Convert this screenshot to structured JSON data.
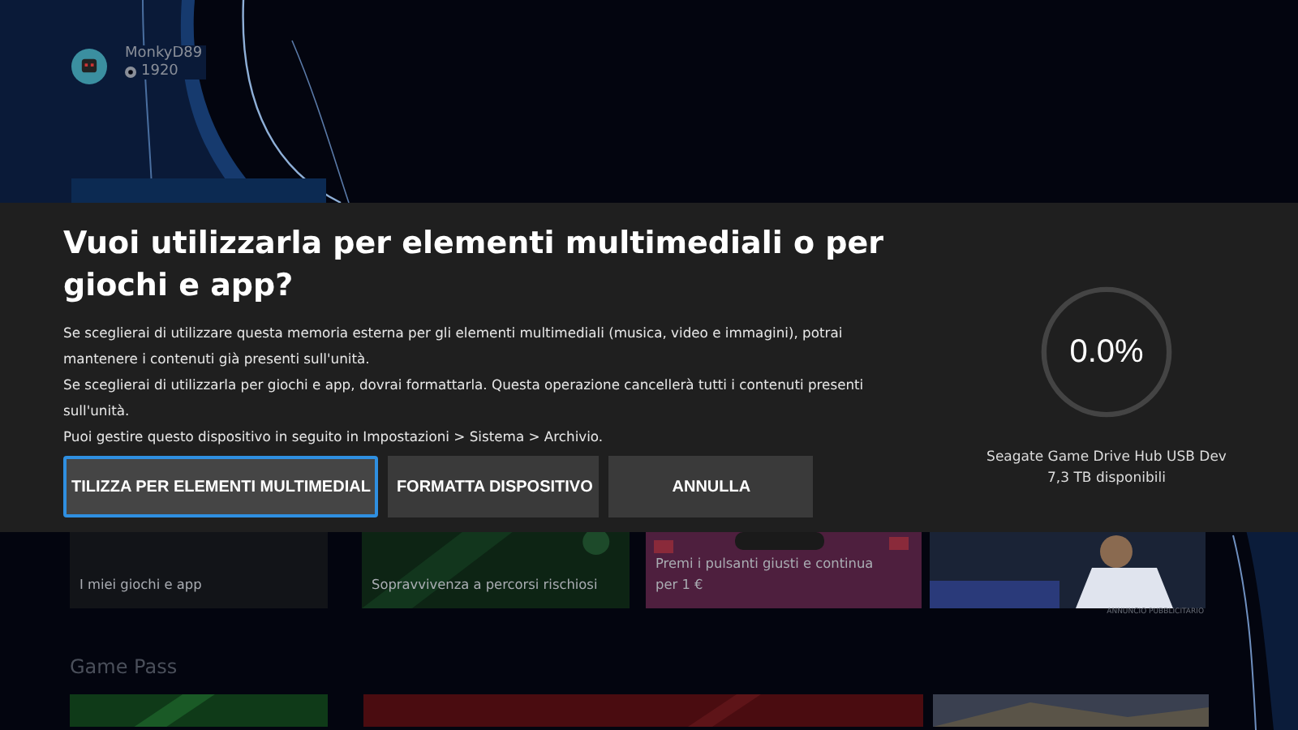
{
  "profile": {
    "gamertag": "MonkyD89",
    "gamerscore": "1920"
  },
  "dialog": {
    "title": "Vuoi utilizzarla per elementi multimediali o per giochi e app?",
    "paragraphs": [
      "Se sceglierai di utilizzare questa memoria esterna per gli elementi multimediali (musica, video e immagini), potrai mantenere i contenuti già presenti sull'unità.",
      "Se sceglierai di utilizzarla per giochi e app, dovrai formattarla. Questa operazione cancellerà tutti i contenuti presenti sull'unità.",
      "Puoi gestire questo dispositivo in seguito in Impostazioni > Sistema > Archivio."
    ],
    "buttons": [
      {
        "label": "TILIZZA PER ELEMENTI MULTIMEDIAL",
        "selected": true
      },
      {
        "label": "FORMATTA DISPOSITIVO",
        "selected": false
      },
      {
        "label": "ANNULLA",
        "selected": false
      }
    ],
    "storage": {
      "reading": "0.0%",
      "device": "Seagate Game Drive Hub USB Dev",
      "free": "7,3 TB disponibili"
    }
  },
  "tiles": [
    {
      "kind": "plain",
      "caption": "I miei giochi e app"
    },
    {
      "kind": "green",
      "caption": "Sopravvivenza a percorsi rischiosi"
    },
    {
      "kind": "pink",
      "caption": "Premi i pulsanti giusti e continua per 1 €"
    },
    {
      "kind": "ad"
    }
  ],
  "ad_label": "ANNUNCIO PUBBLICITARIO",
  "section_title": "Game Pass",
  "bottom_tiles": [
    {
      "kind": "green"
    },
    {
      "kind": "red"
    },
    {
      "kind": "ad"
    }
  ]
}
